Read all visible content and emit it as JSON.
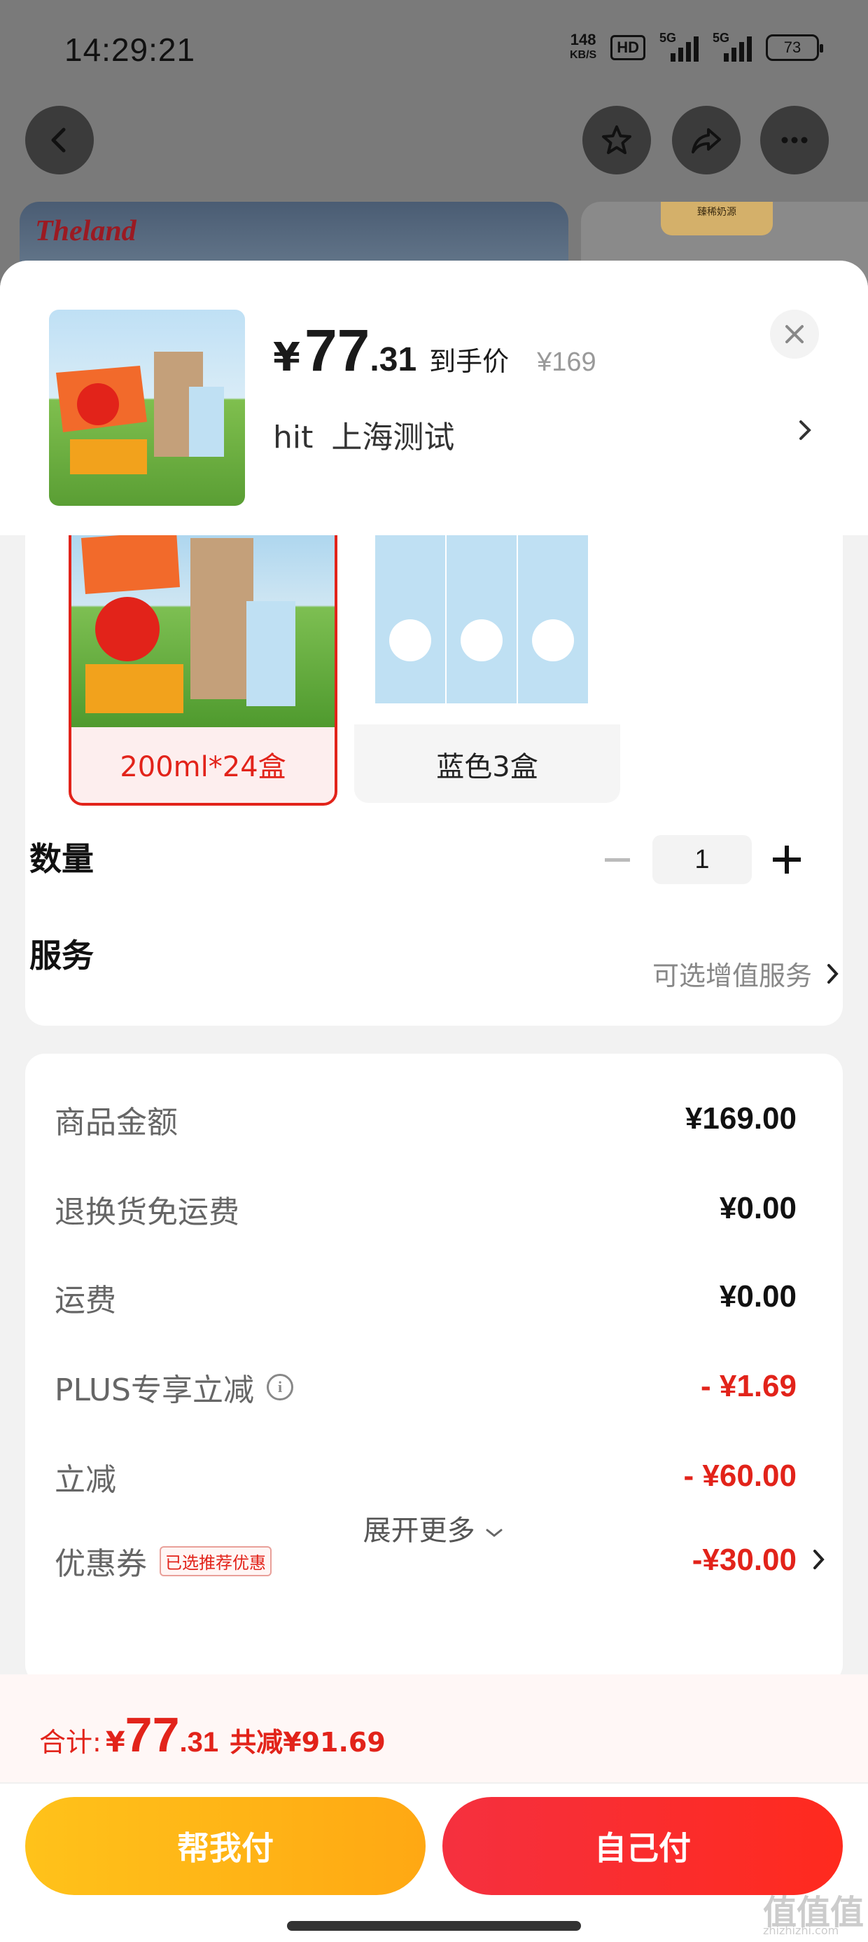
{
  "status": {
    "time": "14:29:21",
    "net_speed_value": "148",
    "net_speed_unit": "KB/S",
    "hd": "HD",
    "sig1": "5G",
    "sig2": "5G",
    "battery": "73"
  },
  "bg_banner": {
    "brand": "Theland",
    "right_tag": "臻稀奶源"
  },
  "sheet": {
    "price": {
      "currency": "¥",
      "integer": "77",
      "decimal": ".31",
      "label": "到手价",
      "original": "¥169"
    },
    "address": {
      "name": "hit",
      "region": "上海测试"
    },
    "variants": [
      {
        "label": "200ml*24盒",
        "selected": true
      },
      {
        "label": "蓝色3盒",
        "selected": false
      }
    ],
    "quantity": {
      "label": "数量",
      "value": "1"
    },
    "service": {
      "label": "服务",
      "value": "可选增值服务"
    }
  },
  "fees": {
    "rows": [
      {
        "key": "商品金额",
        "value": "¥169.00"
      },
      {
        "key": "退换货免运费",
        "value": "¥0.00"
      },
      {
        "key": "运费",
        "value": "¥0.00"
      },
      {
        "key": "PLUS专享立减",
        "value": "- ¥1.69"
      },
      {
        "key": "立减",
        "value": "- ¥60.00"
      },
      {
        "key": "优惠券",
        "value": "-¥30.00",
        "badge": "已选推荐优惠"
      }
    ],
    "expand": "展开更多"
  },
  "footer": {
    "total_label": "合计:",
    "currency": "¥",
    "total_int": "77",
    "total_dec": ".31",
    "saved": "共减¥91.69",
    "help_pay": "帮我付",
    "self_pay": "自己付"
  },
  "watermark": {
    "text": "值值值",
    "url": "zhizhizhi.com"
  },
  "colors": {
    "accent_red": "#e2231a",
    "help_yellow": "#ffb315",
    "self_red": "#f5303f"
  }
}
